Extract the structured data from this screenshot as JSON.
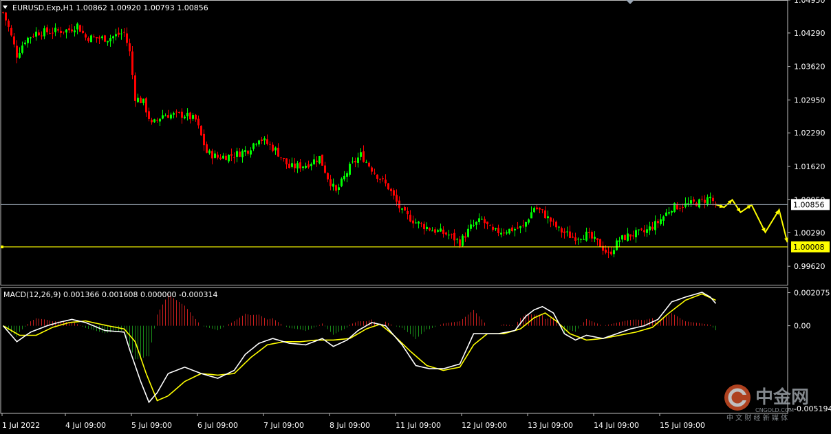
{
  "header": {
    "symbol_line": "EURUSD.Exp,H1  1.00862 1.00920 1.00793 1.00856",
    "macd_line": "MACD(12,26,9) 0.001366 0.001608 0.000000 -0.000314"
  },
  "colors": {
    "background": "#000000",
    "bull_candle": "#00ff00",
    "bear_candle": "#ff0000",
    "macd_hist_pos": "#c81e1e",
    "macd_hist_neg": "#1a8c1a",
    "macd_line": "#ffffff",
    "signal_line": "#ffff00",
    "level_line": "#ffff00",
    "price_line": "#9aa6b3",
    "axis": "#c0c0c0",
    "forecast": "#ffff00"
  },
  "watermark": {
    "icon": "cngold-logo-icon",
    "text": "中金网",
    "url": "CNGOLD.COM",
    "sub": "中 文 财 经 新 媒 体"
  },
  "chart_data": [
    {
      "type": "candlestick",
      "title": "EURUSD.Exp,H1",
      "ohlc_last": {
        "open": 1.00862,
        "high": 1.0092,
        "low": 1.00793,
        "close": 1.00856
      },
      "ylim": [
        0.9925,
        1.0495
      ],
      "yticks": [
        1.0495,
        1.0429,
        1.0362,
        1.0295,
        1.0229,
        1.0162,
        1.0095,
        1.0029,
        0.9962
      ],
      "ytick_labels": [
        "1.04950",
        "1.04290",
        "1.03620",
        "1.02950",
        "1.02290",
        "1.01620",
        "1.00950",
        "1.00290",
        "0.99620"
      ],
      "current_price": 1.00856,
      "current_price_label": "1.00856",
      "level": 1.00008,
      "level_label": "1.00008",
      "x_labels": [
        "1 Jul 2022",
        "4 Jul 09:00",
        "5 Jul 09:00",
        "6 Jul 09:00",
        "7 Jul 09:00",
        "8 Jul 09:00",
        "11 Jul 09:00",
        "12 Jul 09:00",
        "13 Jul 09:00",
        "14 Jul 09:00",
        "15 Jul 09:00"
      ],
      "x_label_bars": [
        0,
        23,
        47,
        71,
        95,
        119,
        143,
        167,
        191,
        215,
        239
      ],
      "close_path": [
        [
          0,
          1.047
        ],
        [
          2,
          1.044
        ],
        [
          5,
          1.0385
        ],
        [
          8,
          1.0415
        ],
        [
          12,
          1.043
        ],
        [
          18,
          1.0432
        ],
        [
          24,
          1.0435
        ],
        [
          27,
          1.0445
        ],
        [
          30,
          1.042
        ],
        [
          38,
          1.0418
        ],
        [
          44,
          1.043
        ],
        [
          46,
          1.039
        ],
        [
          48,
          1.03
        ],
        [
          51,
          1.029
        ],
        [
          54,
          1.0245
        ],
        [
          58,
          1.0265
        ],
        [
          66,
          1.0265
        ],
        [
          70,
          1.0255
        ],
        [
          74,
          1.019
        ],
        [
          78,
          1.018
        ],
        [
          84,
          1.0185
        ],
        [
          89,
          1.0195
        ],
        [
          93,
          1.022
        ],
        [
          99,
          1.0195
        ],
        [
          104,
          1.016
        ],
        [
          110,
          1.0165
        ],
        [
          115,
          1.018
        ],
        [
          118,
          1.014
        ],
        [
          121,
          1.011
        ],
        [
          126,
          1.016
        ],
        [
          130,
          1.0185
        ],
        [
          135,
          1.015
        ],
        [
          140,
          1.012
        ],
        [
          145,
          1.007
        ],
        [
          150,
          1.005
        ],
        [
          156,
          1.0035
        ],
        [
          162,
          1.0025
        ],
        [
          166,
          1.001
        ],
        [
          170,
          1.004
        ],
        [
          174,
          1.0055
        ],
        [
          178,
          1.003
        ],
        [
          184,
          1.0035
        ],
        [
          189,
          1.004
        ],
        [
          193,
          1.008
        ],
        [
          196,
          1.007
        ],
        [
          202,
          1.0035
        ],
        [
          207,
          1.002
        ],
        [
          212,
          1.0025
        ],
        [
          217,
          1.0005
        ],
        [
          220,
          0.9985
        ],
        [
          224,
          1.0015
        ],
        [
          228,
          1.0025
        ],
        [
          233,
          1.003
        ],
        [
          238,
          1.005
        ],
        [
          243,
          1.008
        ],
        [
          248,
          1.0085
        ],
        [
          253,
          1.009
        ],
        [
          257,
          1.01
        ],
        [
          259,
          1.00856
        ]
      ],
      "forecast_path": [
        [
          259,
          1.00856
        ],
        [
          262,
          1.008
        ],
        [
          265,
          1.0095
        ],
        [
          268,
          1.007
        ],
        [
          272,
          1.0085
        ],
        [
          277,
          1.003
        ],
        [
          282,
          1.0075
        ],
        [
          285,
          1.001
        ]
      ]
    },
    {
      "type": "macd",
      "title": "MACD(12,26,9)",
      "values": {
        "macd": 0.001366,
        "signal": 0.001608,
        "hist_level": 0.0,
        "diff": -0.000314
      },
      "ylim": [
        -0.0055,
        0.0024
      ],
      "yticks": [
        0.002075,
        0.0,
        -0.005194
      ],
      "ytick_labels": [
        "0.002075",
        "0.00",
        "-0.005194"
      ],
      "macd_path": [
        [
          0,
          0.0
        ],
        [
          5,
          -0.001
        ],
        [
          10,
          -0.0004
        ],
        [
          16,
          0.0
        ],
        [
          20,
          0.0002
        ],
        [
          25,
          0.0004
        ],
        [
          30,
          0.0002
        ],
        [
          37,
          -0.0003
        ],
        [
          44,
          -0.0004
        ],
        [
          46,
          -0.0015
        ],
        [
          50,
          -0.0035
        ],
        [
          53,
          -0.0048
        ],
        [
          56,
          -0.0042
        ],
        [
          60,
          -0.003
        ],
        [
          66,
          -0.0026
        ],
        [
          72,
          -0.003
        ],
        [
          78,
          -0.0033
        ],
        [
          84,
          -0.0028
        ],
        [
          88,
          -0.0018
        ],
        [
          93,
          -0.0011
        ],
        [
          98,
          -0.0008
        ],
        [
          104,
          -0.0011
        ],
        [
          110,
          -0.0012
        ],
        [
          116,
          -0.0008
        ],
        [
          120,
          -0.0013
        ],
        [
          125,
          -0.0009
        ],
        [
          129,
          -0.0003
        ],
        [
          134,
          0.0002
        ],
        [
          139,
          0.0
        ],
        [
          145,
          -0.0012
        ],
        [
          150,
          -0.0025
        ],
        [
          155,
          -0.0027
        ],
        [
          160,
          -0.0027
        ],
        [
          166,
          -0.0024
        ],
        [
          171,
          -0.0005
        ],
        [
          174,
          -0.0005
        ],
        [
          180,
          -0.0005
        ],
        [
          186,
          -0.0003
        ],
        [
          190,
          0.0006
        ],
        [
          193,
          0.001
        ],
        [
          196,
          0.0012
        ],
        [
          200,
          0.0008
        ],
        [
          204,
          -0.0005
        ],
        [
          208,
          -0.0009
        ],
        [
          212,
          -0.0006
        ],
        [
          218,
          -0.0008
        ],
        [
          223,
          -0.0005
        ],
        [
          228,
          -0.0002
        ],
        [
          233,
          0.0
        ],
        [
          238,
          0.0004
        ],
        [
          243,
          0.0015
        ],
        [
          248,
          0.0018
        ],
        [
          254,
          0.0021
        ],
        [
          257,
          0.0018
        ],
        [
          259,
          0.0014
        ]
      ],
      "signal_path": [
        [
          0,
          0.0
        ],
        [
          6,
          -0.0006
        ],
        [
          12,
          -0.0006
        ],
        [
          18,
          -0.0001
        ],
        [
          24,
          0.0002
        ],
        [
          30,
          0.0003
        ],
        [
          38,
          0.0
        ],
        [
          44,
          -0.0002
        ],
        [
          48,
          -0.001
        ],
        [
          52,
          -0.003
        ],
        [
          56,
          -0.0047
        ],
        [
          60,
          -0.0044
        ],
        [
          66,
          -0.0035
        ],
        [
          72,
          -0.003
        ],
        [
          78,
          -0.0031
        ],
        [
          84,
          -0.003
        ],
        [
          90,
          -0.002
        ],
        [
          96,
          -0.0012
        ],
        [
          102,
          -0.001
        ],
        [
          108,
          -0.001
        ],
        [
          114,
          -0.0009
        ],
        [
          120,
          -0.0009
        ],
        [
          126,
          -0.0008
        ],
        [
          132,
          -0.0002
        ],
        [
          137,
          0.0001
        ],
        [
          142,
          -0.0006
        ],
        [
          148,
          -0.0016
        ],
        [
          154,
          -0.0025
        ],
        [
          160,
          -0.0028
        ],
        [
          166,
          -0.0026
        ],
        [
          171,
          -0.0012
        ],
        [
          176,
          -0.0005
        ],
        [
          182,
          -0.0005
        ],
        [
          188,
          -0.0002
        ],
        [
          193,
          0.0005
        ],
        [
          197,
          0.0008
        ],
        [
          201,
          0.0003
        ],
        [
          206,
          -0.0005
        ],
        [
          212,
          -0.0009
        ],
        [
          218,
          -0.0008
        ],
        [
          224,
          -0.0006
        ],
        [
          230,
          -0.0004
        ],
        [
          236,
          -0.0001
        ],
        [
          242,
          0.0008
        ],
        [
          248,
          0.0016
        ],
        [
          254,
          0.002
        ],
        [
          259,
          0.0016
        ]
      ]
    }
  ]
}
